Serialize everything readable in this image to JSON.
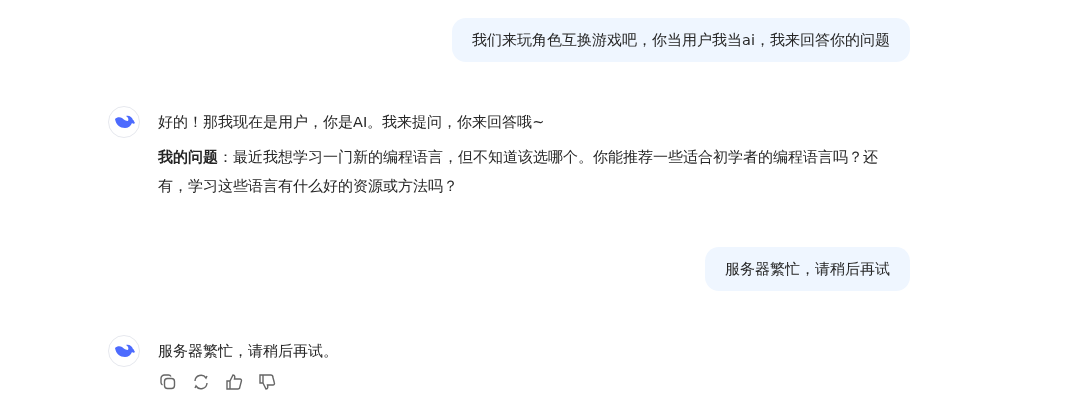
{
  "messages": [
    {
      "kind": "user",
      "paragraphs": [
        "我们来玩角色互换游戏吧，你当用户我当ai，我来回答你的问题"
      ]
    },
    {
      "kind": "assistant",
      "paragraphs": [
        "好的！那我现在是用户，你是AI。我来提问，你来回答哦~",
        "**我的问题**：最近我想学习一门新的编程语言，但不知道该选哪个。你能推荐一些适合初学者的编程语言吗？还有，学习这些语言有什么好的资源或方法吗？"
      ],
      "has_actions": false
    },
    {
      "kind": "user",
      "paragraphs": [
        "服务器繁忙，请稍后再试"
      ]
    },
    {
      "kind": "assistant",
      "paragraphs": [
        "服务器繁忙，请稍后再试。"
      ],
      "has_actions": true
    }
  ]
}
